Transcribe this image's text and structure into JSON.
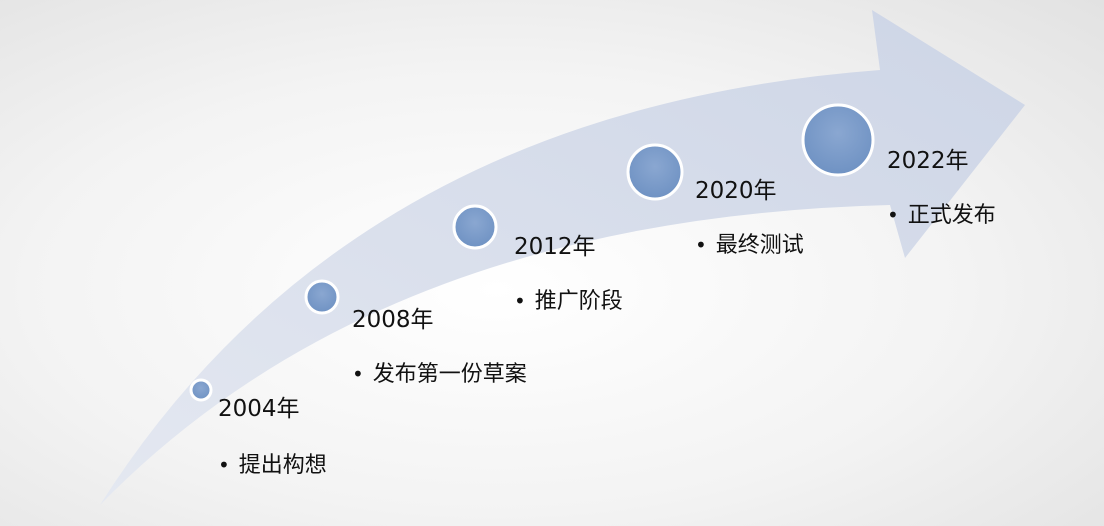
{
  "timeline": {
    "milestones": [
      {
        "year": "2004年",
        "event": "提出构想"
      },
      {
        "year": "2008年",
        "event": "发布第一份草案"
      },
      {
        "year": "2012年",
        "event": "推广阶段"
      },
      {
        "year": "2020年",
        "event": "最终测试"
      },
      {
        "year": "2022年",
        "event": "正式发布"
      }
    ],
    "bullet_symbol": "•",
    "colors": {
      "arrow_fill": "#d3d9e8",
      "circle_fill": "#7a9bc9",
      "circle_stroke": "#ffffff",
      "text": "#111111"
    }
  }
}
